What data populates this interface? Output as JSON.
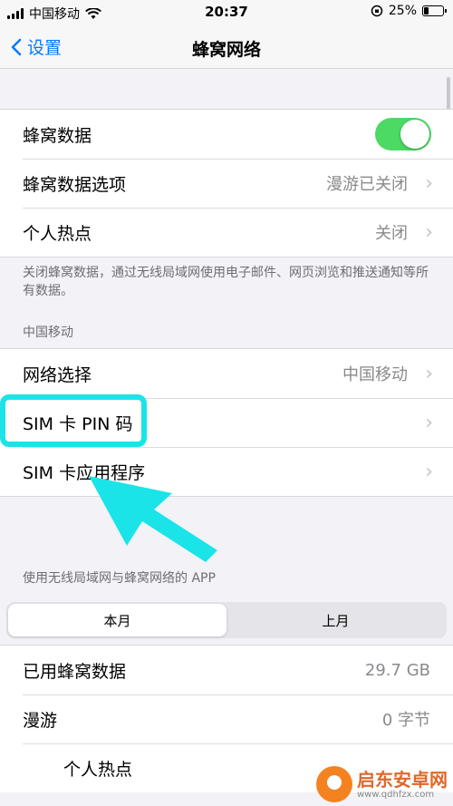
{
  "status_bar": {
    "carrier": "中国移动",
    "time": "20:37",
    "battery": "25%"
  },
  "nav": {
    "back_label": "设置",
    "title": "蜂窝网络"
  },
  "group1": {
    "cellular_data": "蜂窝数据",
    "cellular_options": "蜂窝数据选项",
    "cellular_options_value": "漫游已关闭",
    "hotspot": "个人热点",
    "hotspot_value": "关闭"
  },
  "note1": "关闭蜂窝数据，通过无线局域网使用电子邮件、网页浏览和推送通知等所有数据。",
  "section_carrier": "中国移动",
  "group2": {
    "network_selection": "网络选择",
    "network_selection_value": "中国移动",
    "sim_pin": "SIM 卡 PIN 码",
    "sim_apps": "SIM 卡应用程序"
  },
  "apps_header": "使用无线局域网与蜂窝网络的 APP",
  "segment": {
    "current": "本月",
    "last": "上月"
  },
  "group3": {
    "used_data": "已用蜂窝数据",
    "used_data_value": "29.7 GB",
    "roaming": "漫游",
    "roaming_value": "0 字节",
    "hotspot": "个人热点"
  },
  "watermark": {
    "name": "启东安卓网",
    "url": "www.qdhfzx.com"
  },
  "colors": {
    "accent": "#007aff",
    "toggle_on": "#4cd964",
    "highlight": "#1ae4e8"
  }
}
